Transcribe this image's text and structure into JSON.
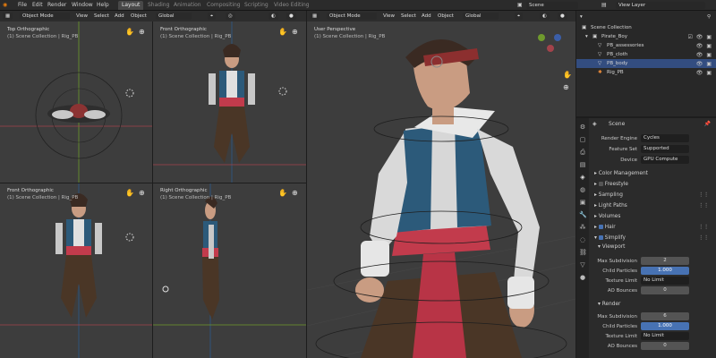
{
  "topbar": {
    "menus": [
      "File",
      "Edit",
      "Render",
      "Window",
      "Help"
    ],
    "workspaces": [
      "Layout",
      "Shading",
      "Animation",
      "Compositing",
      "Scripting",
      "Video Editing"
    ],
    "active_workspace": "Layout",
    "scene": "Scene",
    "view_layer": "View Layer"
  },
  "left_header": {
    "mode": "Object Mode",
    "menus": [
      "View",
      "Select",
      "Add",
      "Object"
    ],
    "orientation": "Global"
  },
  "right_header": {
    "mode": "Object Mode",
    "menus": [
      "View",
      "Select",
      "Add",
      "Object"
    ],
    "orientation": "Global"
  },
  "viewports": [
    {
      "title": "Top Orthographic",
      "subtitle": "(1) Scene Collection | Rig_PB"
    },
    {
      "title": "Front Orthographic",
      "subtitle": "(1) Scene Collection | Rig_PB"
    },
    {
      "title": "Front Orthographic",
      "subtitle": "(1) Scene Collection | Rig_PB"
    },
    {
      "title": "Right Orthographic",
      "subtitle": "(1) Scene Collection | Rig_PB"
    },
    {
      "title": "User Perspective",
      "subtitle": "(1) Scene Collection | Rig_PB"
    }
  ],
  "outliner": {
    "root": "Scene Collection",
    "items": [
      "Pirate_Boy",
      "PB_assessories",
      "PB_cloth",
      "PB_body",
      "Rig_PB"
    ]
  },
  "properties": {
    "header": "Scene",
    "render_engine_label": "Render Engine",
    "render_engine": "Cycles",
    "feature_set_label": "Feature Set",
    "feature_set": "Supported",
    "device_label": "Device",
    "device": "GPU Compute",
    "panels": [
      "Color Management",
      "Freestyle",
      "Sampling",
      "Light Paths",
      "Volumes",
      "Hair",
      "Simplify"
    ],
    "viewport_label": "Viewport",
    "render_label": "Render",
    "viewport": {
      "max_subdivision_label": "Max Subdivision",
      "max_subdivision": "2",
      "child_particles_label": "Child Particles",
      "child_particles": "1.000",
      "texture_limit_label": "Texture Limit",
      "texture_limit": "No Limit",
      "ao_bounces_label": "AO Bounces",
      "ao_bounces": "0"
    },
    "render": {
      "max_subdivision_label": "Max Subdivision",
      "max_subdivision": "6",
      "child_particles_label": "Child Particles",
      "child_particles": "1.000",
      "texture_limit_label": "Texture Limit",
      "texture_limit": "No Limit",
      "ao_bounces_label": "AO Bounces",
      "ao_bounces": "0"
    }
  },
  "colors": {
    "viewport_bg": "#3d3d3d",
    "selection": "#334d80",
    "accent_blue": "#4772b3",
    "axis_red": "#a3434b",
    "axis_green": "#6f9a2d"
  }
}
